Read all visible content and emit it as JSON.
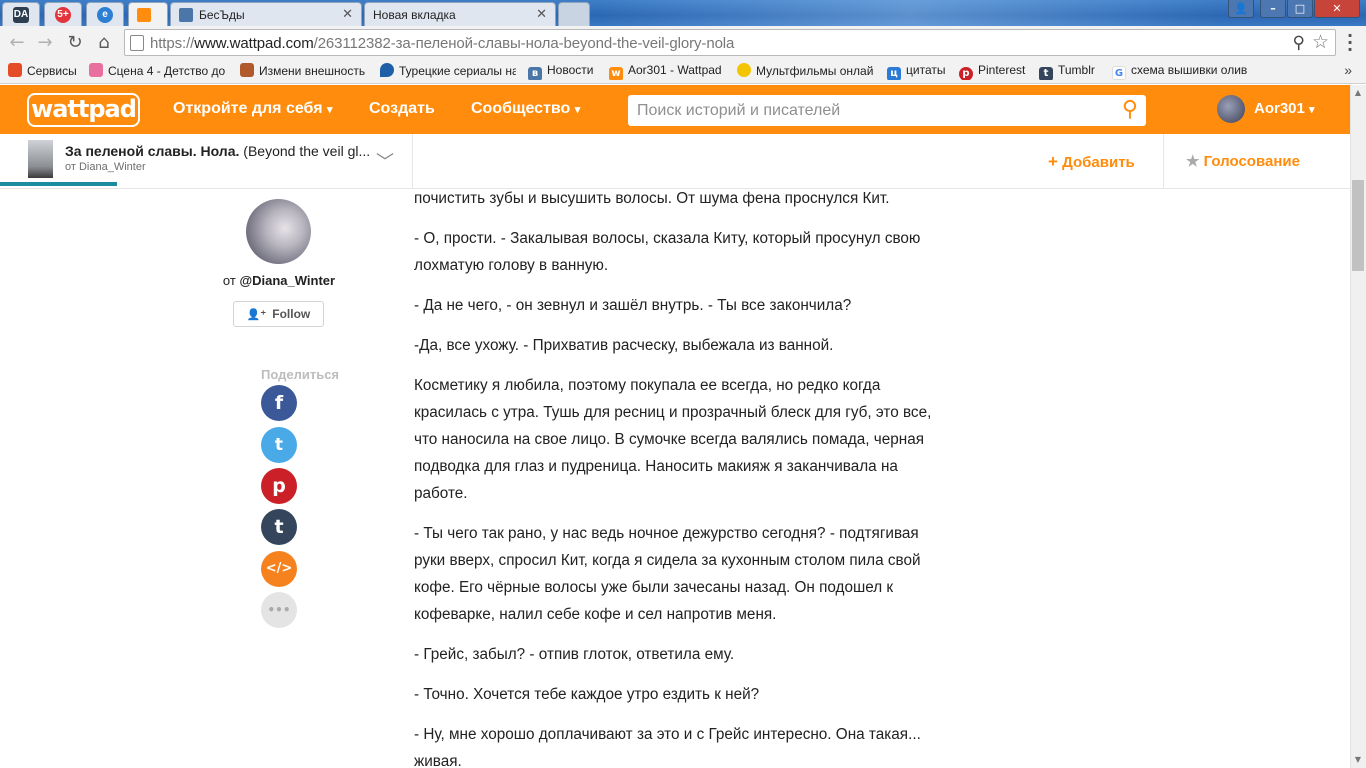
{
  "browser": {
    "pinned_tabs": [
      {
        "icon": "DA",
        "color": "#2c3e50"
      },
      {
        "icon": "5+",
        "color": "#e2343a"
      },
      {
        "icon": "e",
        "color": "#2d7fd3"
      }
    ],
    "tabs": [
      {
        "title": "",
        "active": true,
        "favicon_color": "#ff8c0c"
      },
      {
        "title": "БесЪды",
        "active": false,
        "favicon_color": "#4a76a8"
      },
      {
        "title": "Новая вкладка",
        "active": false,
        "favicon_color": "#ffffff"
      }
    ],
    "window_controls": {
      "minimize": "–",
      "maximize": "□",
      "close": "✕"
    },
    "url": {
      "scheme": "https://",
      "host": "www.wattpad.com",
      "path": "/263112382-за-пеленой-славы-нола-beyond-the-veil-glory-nola"
    },
    "bookmarks": [
      {
        "label": "Сервисы",
        "icon_color": "#e34c26"
      },
      {
        "label": "Сцена 4 - Детство до",
        "icon_color": "#e86f9e"
      },
      {
        "label": "Измени внешность",
        "icon_color": "#b05a2b"
      },
      {
        "label": "Турецкие сериалы на",
        "icon_color": "#1f5fa8"
      },
      {
        "label": "Новости",
        "icon_color": "#4a76a8"
      },
      {
        "label": "Aor301 - Wattpad",
        "icon_color": "#ff8c0c"
      },
      {
        "label": "Мультфильмы онлай",
        "icon_color": "#f2c500"
      },
      {
        "label": "цитаты",
        "icon_color": "#2a7ad6"
      },
      {
        "label": "Pinterest",
        "icon_color": "#cb2027"
      },
      {
        "label": "Tumblr",
        "icon_color": "#35465c"
      },
      {
        "label": "схема вышивки олив",
        "icon_color": "#4285f4"
      }
    ]
  },
  "wattpad": {
    "logo": "wattpad",
    "nav": {
      "discover": "Откройте для себя",
      "create": "Создать",
      "community": "Сообщество"
    },
    "search_placeholder": "Поиск историй и писателей",
    "user": "Aor301",
    "accent": "#ff8c0c"
  },
  "story": {
    "title_bold": "За пеленой славы. Нола.",
    "title_rest": " (Beyond the veil gl...",
    "author_line": "от Diana_Winter",
    "add_label": "Добавить",
    "vote_label": "Голосование",
    "reading_progress": 0.087
  },
  "author": {
    "prefix": "от ",
    "handle": "@Diana_Winter",
    "follow_label": "Follow"
  },
  "share": {
    "label": "Поделиться",
    "buttons": [
      {
        "name": "facebook",
        "glyph": "f",
        "color": "#3b5998"
      },
      {
        "name": "twitter",
        "glyph": "t",
        "color": "#4aaae8"
      },
      {
        "name": "pinterest",
        "glyph": "p",
        "color": "#cb2027"
      },
      {
        "name": "tumblr",
        "glyph": "t",
        "color": "#35465c"
      },
      {
        "name": "embed",
        "glyph": "</>",
        "color": "#f6821f"
      },
      {
        "name": "more",
        "glyph": "•••",
        "color": "#e4e4e4"
      }
    ]
  },
  "article": {
    "paragraphs": [
      "почистить зубы и высушить волосы. От шума фена проснулся Кит.",
      "- О, прости. - Закалывая волосы, сказала Киту, который просунул свою лохматую голову в ванную.",
      "- Да не чего, - он зевнул и зашёл внутрь. - Ты все закончила?",
      "-Да, все ухожу. - Прихватив расческу, выбежала из ванной.",
      "Косметику я любила, поэтому покупала ее всегда, но редко когда красилась с утра. Тушь для ресниц и прозрачный блеск для губ, это все, что наносила на свое лицо. В сумочке всегда валялись помада, черная подводка для глаз и пудреница. Наносить макияж я заканчивала на работе.",
      "- Ты чего так рано, у нас ведь ночное дежурство сегодня? - подтягивая руки вверх, спросил Кит, когда я сидела за кухонным столом пила свой кофе. Его чёрные волосы уже были зачесаны назад. Он подошел к кофеварке, налил себе кофе и сел напротив меня.",
      "- Грейс, забыл? - отпив глоток, ответила ему.",
      "- Точно. Хочется тебе каждое утро ездить к ней?",
      "- Ну, мне хорошо доплачивают за это и с Грейс интересно. Она такая... живая."
    ]
  }
}
